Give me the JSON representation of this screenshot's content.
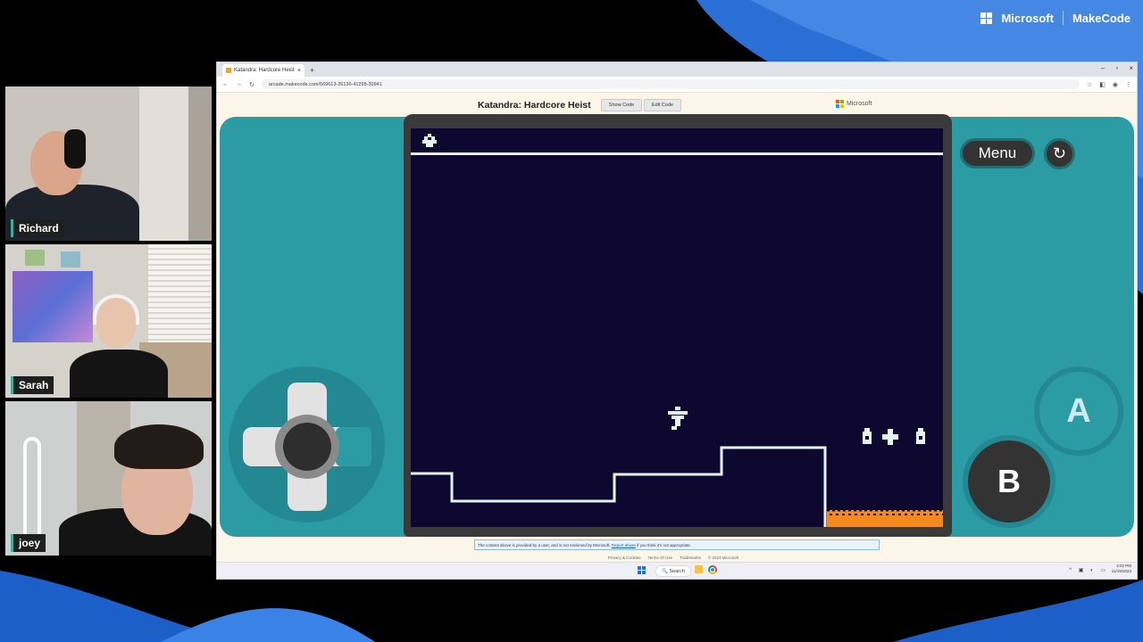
{
  "stream": {
    "brand_company": "Microsoft",
    "brand_product": "MakeCode",
    "participants": [
      {
        "name": "Richard"
      },
      {
        "name": "Sarah"
      },
      {
        "name": "joey"
      }
    ]
  },
  "browser": {
    "tab_title": "Katandra: Hardcore Heist",
    "url": "arcade.makecode.com/569613-26136-41295-30941",
    "window_controls": [
      "–",
      "▫",
      "×"
    ]
  },
  "app": {
    "title": "Katandra: Hardcore Heist",
    "show_code_label": "Show Code",
    "edit_code_label": "Edit Code",
    "ms_label": "Microsoft"
  },
  "console": {
    "menu_label": "Menu",
    "reset_icon": "↻",
    "a_label": "A",
    "b_label": "B",
    "colors": {
      "body": "#2b9ba4",
      "screen": "#0e0730",
      "floor": "#e6f2f2",
      "lava": "#f28a1d"
    }
  },
  "footer": {
    "disclaimer_text": "The content above is provided by a user, and is not endorsed by Microsoft.",
    "disclaimer_link": "Report abuse",
    "disclaimer_tail": "if you think it's not appropriate.",
    "links": [
      "Privacy & Cookies",
      "Terms Of Use",
      "Trademarks",
      "© 2023 Microsoft"
    ]
  },
  "taskbar": {
    "search_label": "Search",
    "time": "2:02 PM",
    "date": "11/19/2023"
  }
}
